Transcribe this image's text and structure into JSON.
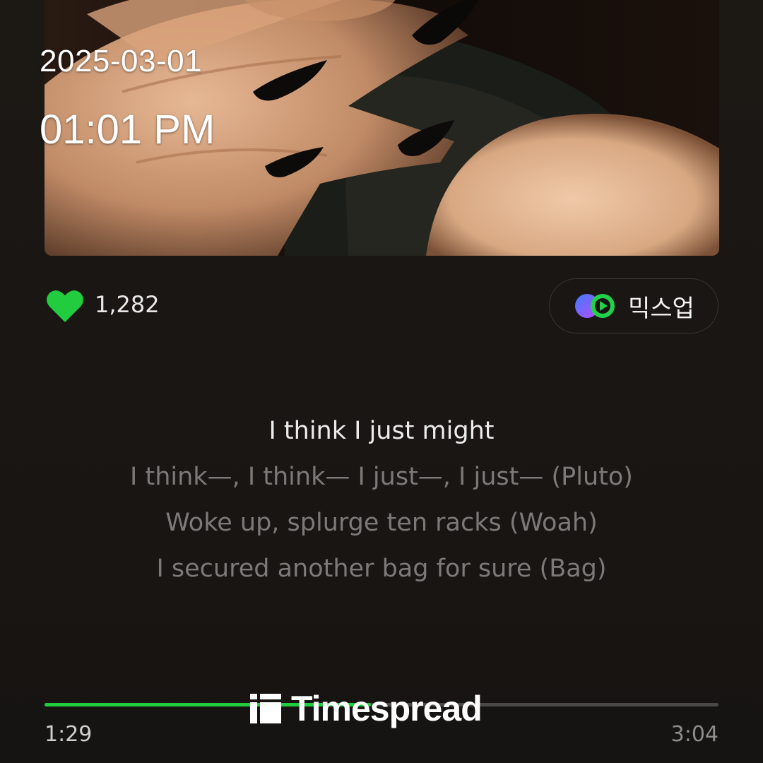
{
  "status": {
    "date": "2025-03-01",
    "time": "01:01 PM"
  },
  "album_art": {
    "icon": "album-cover-image"
  },
  "actions": {
    "like_count": "1,282",
    "like_icon": "heart-icon",
    "mixup_label": "믹스업",
    "mixup_icon": "mixup-icon"
  },
  "lyrics": {
    "active_index": 0,
    "lines": [
      "I think I just might",
      "I think—, I think— I just—, I just— (Pluto)",
      "Woke up, splurge ten racks (Woah)",
      "I secured another bag for sure (Bag)"
    ]
  },
  "playback": {
    "elapsed": "1:29",
    "duration": "3:04",
    "progress_fraction": 0.484
  },
  "watermark": {
    "brand": "Timespread",
    "logo": "timespread-logo"
  },
  "colors": {
    "accent": "#21cc3e",
    "background": "#171513"
  }
}
